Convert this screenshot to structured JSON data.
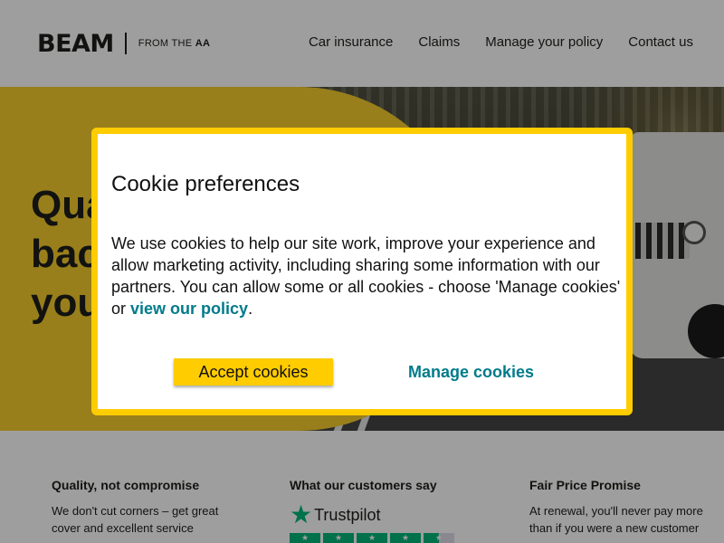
{
  "header": {
    "logo_text": "BEAM",
    "logo_sub_prefix": "FROM THE",
    "logo_sub_brand": "AA",
    "nav": [
      "Car insurance",
      "Claims",
      "Manage your policy",
      "Contact us"
    ]
  },
  "hero": {
    "heading_visible": [
      "Qua",
      "bac",
      "you"
    ]
  },
  "features": [
    {
      "title": "Quality, not compromise",
      "text": "We don't cut corners – get great cover and excellent service"
    },
    {
      "title": "What our customers say",
      "trustpilot": "Trustpilot"
    },
    {
      "title": "Fair Price Promise",
      "text": "At renewal, you'll never pay more than if you were a new customer"
    }
  ],
  "cookie_dialog": {
    "title": "Cookie preferences",
    "body": "We use cookies to help our site work, improve your experience and allow marketing activity, including sharing some information with our partners. You can allow some or all cookies - choose 'Manage cookies' or ",
    "policy_link": "view our policy",
    "body_end": ".",
    "accept_label": "Accept cookies",
    "manage_label": "Manage cookies"
  },
  "colors": {
    "accent_yellow": "#ffcc00",
    "link_teal": "#007b8b",
    "trustpilot_green": "#00b67a"
  },
  "trustpilot_rating": 4.5
}
